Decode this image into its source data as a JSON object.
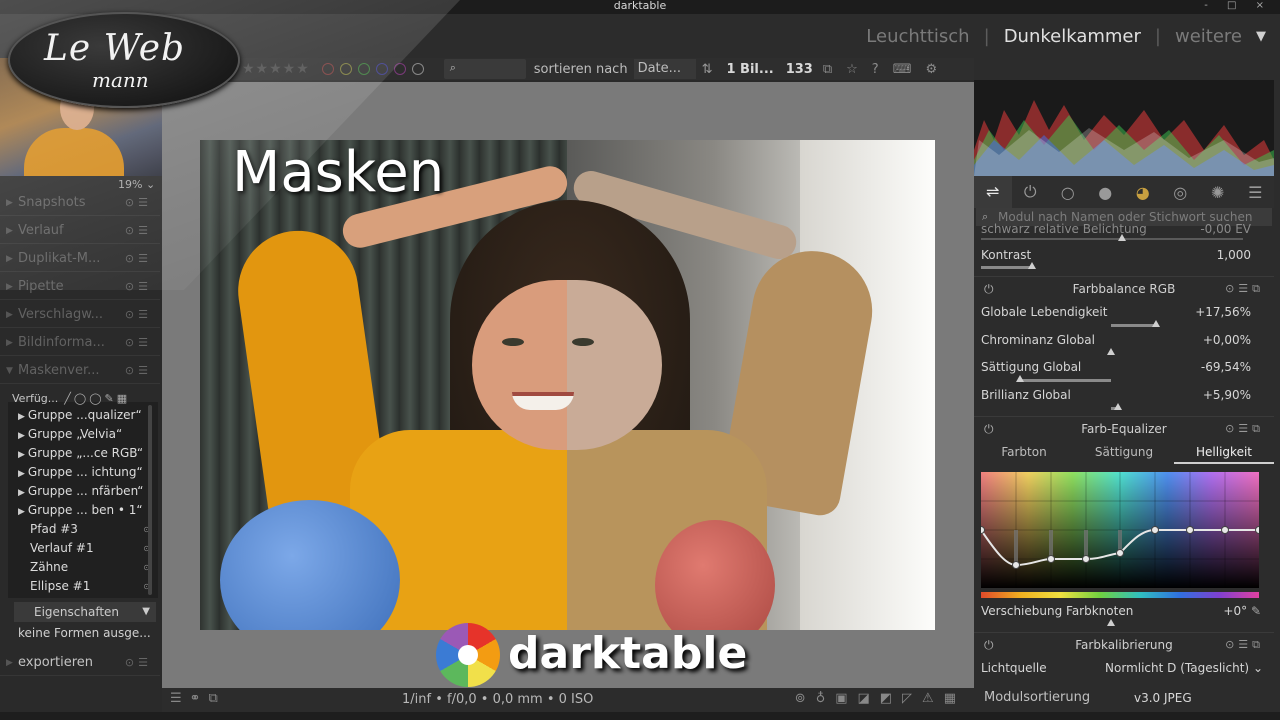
{
  "window": {
    "title": "darktable",
    "controls": "- □ ×"
  },
  "views": {
    "lighttable": "Leuchttisch",
    "darkroom": "Dunkelkammer",
    "more": "weitere",
    "sep": "|"
  },
  "toolbar": {
    "sort_label": "sortieren nach",
    "sort_value": "Date...",
    "selection": "1 Bil...",
    "count": "133"
  },
  "left": {
    "zoom": "19%",
    "modules": [
      {
        "label": "Snapshots"
      },
      {
        "label": "Verlauf"
      },
      {
        "label": "Duplikat-M..."
      },
      {
        "label": "Pipette"
      },
      {
        "label": "Verschlagw..."
      },
      {
        "label": "Bildinforma..."
      },
      {
        "label": "Maskenver..."
      }
    ],
    "mask_header": "Verfüg...",
    "mask_items": [
      {
        "label": "Gruppe ...qualizer“",
        "group": true
      },
      {
        "label": "Gruppe „Velvia“",
        "group": true
      },
      {
        "label": "Gruppe „...ce RGB“",
        "group": true
      },
      {
        "label": "Gruppe ... ichtung“",
        "group": true
      },
      {
        "label": "Gruppe ... nfärben“",
        "group": true
      },
      {
        "label": "Gruppe ... ben • 1“",
        "group": true
      },
      {
        "label": "Pfad #3",
        "group": false
      },
      {
        "label": "Verlauf #1",
        "group": false
      },
      {
        "label": "Zähne",
        "group": false
      },
      {
        "label": "Ellipse #1",
        "group": false
      }
    ],
    "properties": "Eigenschaften",
    "no_shapes": "keine Formen ausge...",
    "export": "exportieren"
  },
  "center": {
    "overlay_title": "Masken",
    "brand": "darktable",
    "logo_top": "Le Web",
    "logo_bottom": "mann"
  },
  "bottombar": {
    "exif": "1/inf • f/0,0 • 0,0 mm • 0 ISO"
  },
  "right": {
    "search_placeholder": "Modul nach Namen oder Stichwort suchen",
    "partial_row": {
      "label": "schwarz relative Belichtung",
      "value": "-0,00 EV"
    },
    "contrast": {
      "label": "Kontrast",
      "value": "1,000"
    },
    "farbbalance": {
      "title": "Farbbalance RGB",
      "rows": [
        {
          "label": "Globale Lebendigkeit",
          "value": "+17,56%"
        },
        {
          "label": "Chrominanz Global",
          "value": "+0,00%"
        },
        {
          "label": "Sättigung Global",
          "value": "-69,54%"
        },
        {
          "label": "Brillianz Global",
          "value": "+5,90%"
        }
      ]
    },
    "equalizer": {
      "title": "Farb-Equalizer",
      "tabs": [
        "Farbton",
        "Sättigung",
        "Helligkeit"
      ],
      "shift_label": "Verschiebung Farbknoten",
      "shift_value": "+0°"
    },
    "calibration": {
      "title": "Farbkalibrierung",
      "light_label": "Lichtquelle",
      "light_value": "Normlicht D (Tageslicht)"
    },
    "module_order": "Modulsortierung",
    "module_order_value": "v3.0 JPEG"
  }
}
